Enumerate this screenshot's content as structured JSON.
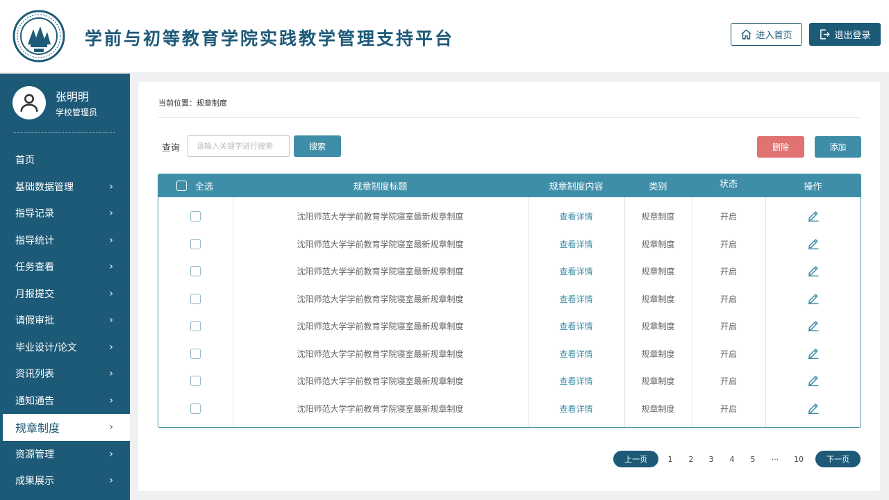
{
  "header": {
    "title": "学前与初等教育学院实践教学管理支持平台",
    "home_label": "进入首页",
    "logout_label": "退出登录"
  },
  "user": {
    "name": "张明明",
    "role": "学校管理员"
  },
  "sidebar": {
    "items": [
      {
        "label": "首页",
        "has_arrow": false
      },
      {
        "label": "基础数据管理",
        "has_arrow": true
      },
      {
        "label": "指导记录",
        "has_arrow": true
      },
      {
        "label": "指导统计",
        "has_arrow": true
      },
      {
        "label": "任务查看",
        "has_arrow": true
      },
      {
        "label": "月报提交",
        "has_arrow": true
      },
      {
        "label": "请假审批",
        "has_arrow": true
      },
      {
        "label": "毕业设计/论文",
        "has_arrow": true
      },
      {
        "label": "资讯列表",
        "has_arrow": true
      },
      {
        "label": "通知通告",
        "has_arrow": true
      },
      {
        "label": "规章制度",
        "has_arrow": true,
        "active": true
      },
      {
        "label": "资源管理",
        "has_arrow": true
      },
      {
        "label": "成果展示",
        "has_arrow": true
      }
    ]
  },
  "breadcrumb": "当前位置：规章制度",
  "toolbar": {
    "query_label": "查询",
    "search_placeholder": "请输入关键字进行搜索",
    "search_label": "搜索",
    "delete_label": "删除",
    "add_label": "添加"
  },
  "table": {
    "select_all_label": "全选",
    "columns": [
      "规章制度标题",
      "规章制度内容",
      "类别",
      "状态",
      "操作"
    ],
    "rows": [
      {
        "title": "沈阳师范大学学前教育学院寝室最新规章制度",
        "content": "查看详情",
        "category": "规章制度",
        "status": "开启"
      },
      {
        "title": "沈阳师范大学学前教育学院寝室最新规章制度",
        "content": "查看详情",
        "category": "规章制度",
        "status": "开启"
      },
      {
        "title": "沈阳师范大学学前教育学院寝室最新规章制度",
        "content": "查看详情",
        "category": "规章制度",
        "status": "开启"
      },
      {
        "title": "沈阳师范大学学前教育学院寝室最新规章制度",
        "content": "查看详情",
        "category": "规章制度",
        "status": "开启"
      },
      {
        "title": "沈阳师范大学学前教育学院寝室最新规章制度",
        "content": "查看详情",
        "category": "规章制度",
        "status": "开启"
      },
      {
        "title": "沈阳师范大学学前教育学院寝室最新规章制度",
        "content": "查看详情",
        "category": "规章制度",
        "status": "开启"
      },
      {
        "title": "沈阳师范大学学前教育学院寝室最新规章制度",
        "content": "查看详情",
        "category": "规章制度",
        "status": "开启"
      },
      {
        "title": "沈阳师范大学学前教育学院寝室最新规章制度",
        "content": "查看详情",
        "category": "规章制度",
        "status": "开启"
      }
    ]
  },
  "pagination": {
    "prev_label": "上一页",
    "next_label": "下一页",
    "pages": [
      "1",
      "2",
      "3",
      "4",
      "5",
      "···",
      "10"
    ]
  },
  "colors": {
    "primary": "#1d5a78",
    "accent": "#3f8ea8",
    "danger": "#e07272"
  }
}
